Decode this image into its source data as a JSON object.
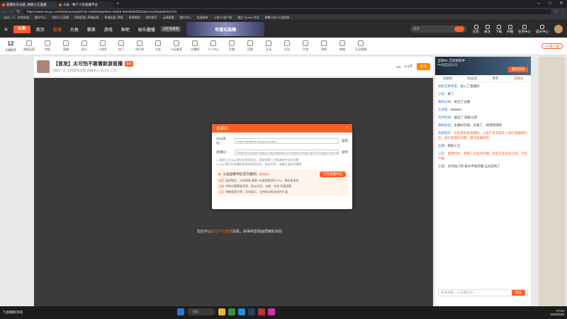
{
  "browser": {
    "tabs": [
      {
        "title": "超镇民白马路_铜帆小王直播"
      },
      {
        "title": "斗鱼 - 每个人的直播平台"
      }
    ],
    "url": "https://www.douyu.com/beta/topic/pabl?rid=230693&dyshid=d1b69-30ed9d0df1f33a51c6cd3aaa00011701",
    "bookmarks": [
      "自由一下，你就知道",
      "猫叶中心",
      "刘帆小王直播",
      "草根起源_草根起源",
      "草根起源_草根",
      "草根微视",
      "我的首页",
      "云端直播",
      "猫叶中心",
      "快速指南",
      "斗鱼PC客户端",
      "通过 Torrent 共享",
      "腾腾斗鱼 PC游戏版"
    ]
  },
  "site": {
    "logo": "斗鱼",
    "nav": [
      "首页",
      "直播",
      "分类",
      "赛事",
      "游戏",
      "鱼吧",
      "娱乐趣播"
    ],
    "nav_active": "直播",
    "promo_label": "分区高能夜",
    "banner_text": "年度化装舞",
    "search_placeholder": "搜索",
    "tools": [
      "历史",
      "关注",
      "下载",
      "开播",
      "任务中心",
      "成长中心"
    ]
  },
  "categories": {
    "count": "12",
    "count_label": "主播推荐",
    "items": [
      "超级英豪",
      "特权",
      "直播",
      "音乐",
      "小程序",
      "热门",
      "排行榜",
      "分类",
      "分区推荐",
      "主播榜",
      "个人中心",
      "开播",
      "设置",
      "互动",
      "活动",
      "手游",
      "鱼吧",
      "商城",
      "互动直播"
    ],
    "pc_button": "PC客户端"
  },
  "room": {
    "title": "【首发】太可怕不敢看新游首播",
    "tag": "首发",
    "meta": "铜帆小王  主机游戏首播  直播中心  关注(1.1万)",
    "followers": "5.1万",
    "follow_label": "关注",
    "fans_label": "1/1",
    "overlay_text": "如还可以",
    "overlay_link": "前往户外直播",
    "overlay_rest": "观看，获得纯享版画质精彩体验"
  },
  "modal": {
    "title": "推流码",
    "close": "×",
    "rtmp_label": "rtmp地址：",
    "rtmp_value": "rtmp://sendfhe1.douyu.com/live",
    "stream_label": "直播码：",
    "stream_value": "230693rGb1K6d?d9a0ec79f2n6pf0ksf21lT/uh6&txSecret=4f22a7f7c9&txTime=6592ABF2&authcore=sign",
    "copy_label": "复制",
    "tips": [
      "1. 复制上方rtmp地址及推流码后，粘贴到第三方推流软件对应位置",
      "2. rtmp地址及直播码是您的私密信息，请勿外泄，泄露后请及时重置"
    ],
    "promo_title": "斗鱼直播伴侣(官方推荐)",
    "promo_badge": "推荐使用",
    "promo_button": "打开直播伴侣",
    "promo_lines": [
      {
        "tag": "画质",
        "text": "画质稳定、光效清晰 美颜+去噪帧数提升20%，播出更清爽"
      },
      {
        "tag": "功能",
        "text": "特殊设置覆盖率高，独立应用，金额、礼物 双重提醒"
      },
      {
        "tag": "互动",
        "text": "弹幕管理方便，实时展示，支持新功能及插件扩展"
      }
    ]
  },
  "sidebar": {
    "ad_title": "全新PK 刀灵领军中",
    "ad_sub": "PK就是战斗力",
    "ad_button": "最新活动",
    "tabs": [
      "贡献榜",
      "粉丝团",
      "贵宾",
      "直播间"
    ],
    "active_tab": "直播间",
    "messages": [
      {
        "name": "铜帆至尊荣誉",
        "text": "进入了直播间"
      },
      {
        "name": "小饭",
        "text": "来了"
      },
      {
        "name": "晚风过境",
        "text": "关注了主播"
      },
      {
        "name": "天涯客",
        "text": "666666"
      },
      {
        "name": "风中的你",
        "text": "送出了 超级火箭"
      },
      {
        "name": "铜帆粉丝",
        "text": "主播好厉害，太强了，哈哈哈哈哈"
      },
      {
        "name": "系统提示",
        "text": "欢迎来到本直播间，斗鱼严禁未成年人进行直播或打赏，请大家理性消费，遵守直播规范"
      },
      {
        "name": "主播",
        "text": "铜帆小王"
      },
      {
        "name": "公告",
        "text": "直播时间：每晚八点准时开播，欢迎大家关注订阅，不见不散"
      },
      {
        "name": "主播",
        "text": "太可怕了吧 每天半夜开播 这太恐怖了"
      }
    ],
    "input_placeholder": "发送弹幕，与主播互动",
    "send_label": "发送"
  },
  "taskbar": {
    "weather": "气温晴朗 阵风",
    "search": "搜索",
    "time": "17:44",
    "date": "2023/11/6"
  }
}
